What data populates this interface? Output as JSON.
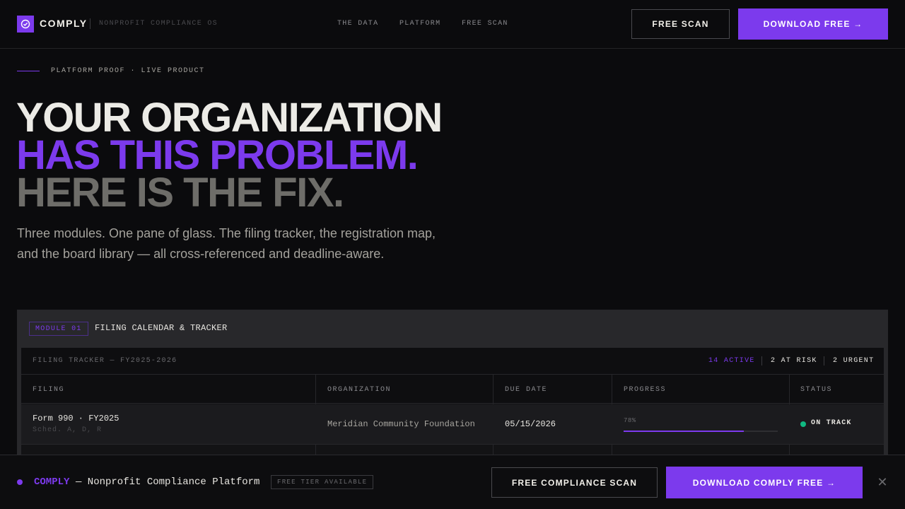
{
  "nav": {
    "brand": "COMPLY",
    "tagline": "NONPROFIT COMPLIANCE OS",
    "links": [
      "THE DATA",
      "PLATFORM",
      "FREE SCAN"
    ],
    "free_scan_button": "FREE SCAN",
    "download_button": "DOWNLOAD FREE →"
  },
  "hero": {
    "eyebrow": "PLATFORM PROOF · LIVE PRODUCT",
    "headline_1": "YOUR ORGANIZATION",
    "headline_2": "HAS THIS PROBLEM.",
    "headline_3": "HERE IS THE FIX.",
    "lead": "Three modules. One pane of glass. The filing tracker, the registration map, and the board library — all cross-referenced and deadline-aware."
  },
  "module": {
    "badge": "MODULE 01",
    "title": "FILING CALENDAR & TRACKER",
    "tracker": {
      "title": "FILING TRACKER — FY2025-2026",
      "stats": {
        "active": "14 ACTIVE",
        "at_risk": "2 AT RISK",
        "urgent": "2 URGENT"
      },
      "columns": [
        "FILING",
        "ORGANIZATION",
        "DUE DATE",
        "PROGRESS",
        "STATUS"
      ],
      "rows": [
        {
          "filing": "Form 990 · FY2025",
          "schedules": "Sched. A, D, R",
          "organization": "Meridian Community Foundation",
          "due_date": "05/15/2026",
          "progress_label": "78%",
          "progress": 0.78,
          "status": "ON TRACK"
        }
      ]
    }
  },
  "bottom_bar": {
    "brand": "COMPLY",
    "text": "— Nonprofit Compliance Platform",
    "badge": "FREE TIER AVAILABLE",
    "scan_button": "FREE COMPLIANCE SCAN",
    "download_button": "DOWNLOAD COMPLY FREE →",
    "close": "✕"
  },
  "colors": {
    "accent": "#7c3aed",
    "status_on_track": "#10b981",
    "background": "#0b0b0d"
  }
}
